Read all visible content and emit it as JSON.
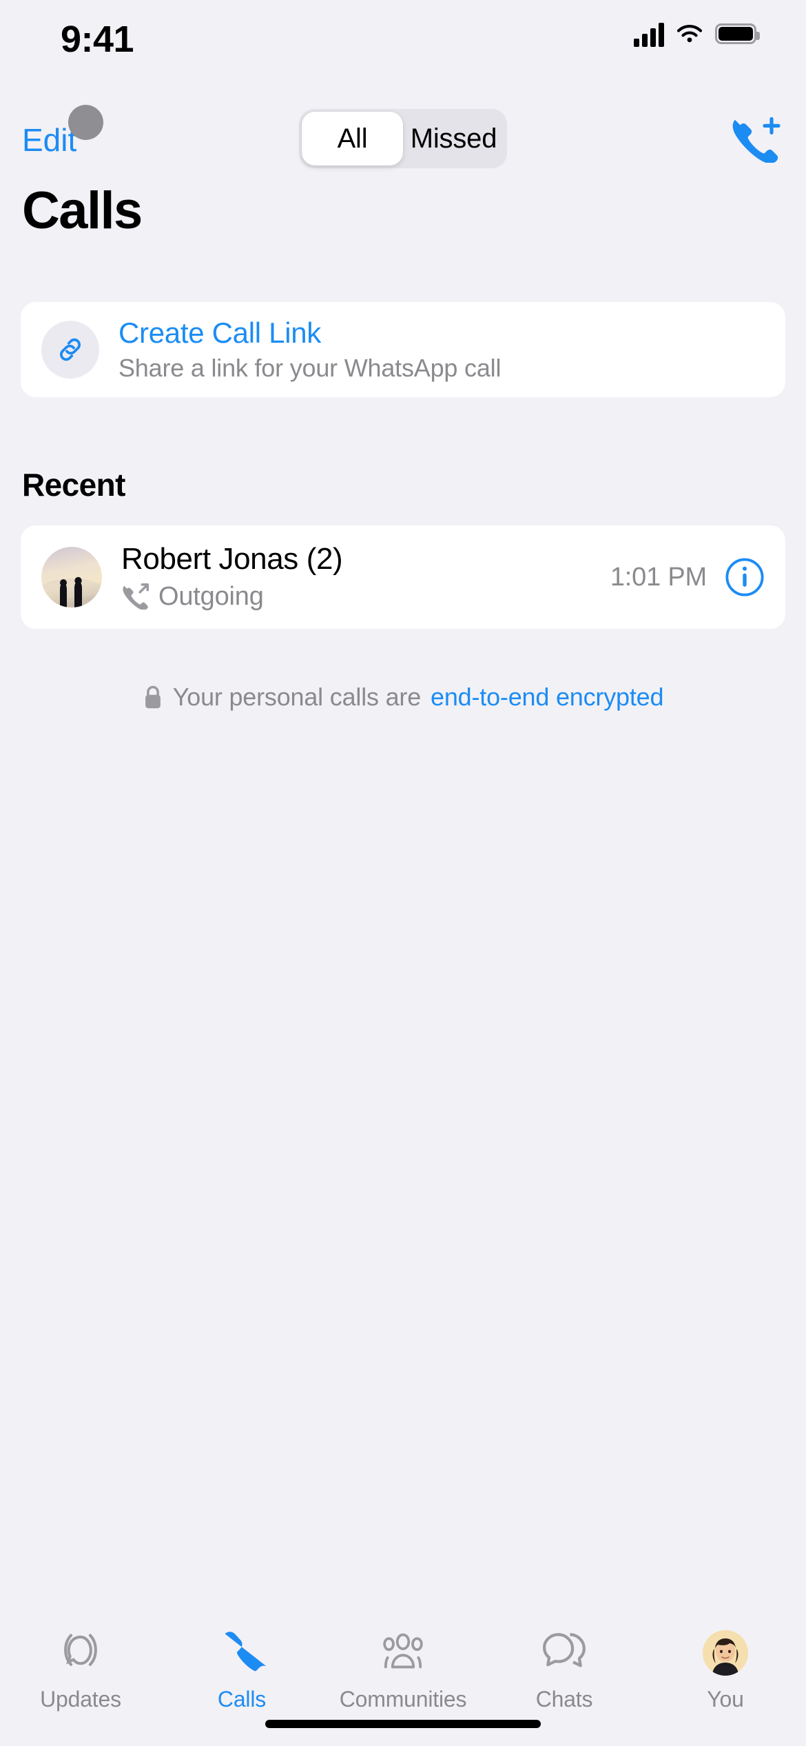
{
  "status_bar": {
    "time": "9:41",
    "signal_icon": "cellular-signal-icon",
    "wifi_icon": "wifi-icon",
    "battery_icon": "battery-icon"
  },
  "nav": {
    "edit_label": "Edit",
    "segments": [
      {
        "label": "All",
        "active": true
      },
      {
        "label": "Missed",
        "active": false
      }
    ],
    "new_call_icon": "phone-plus-icon"
  },
  "header": {
    "title": "Calls",
    "cursor_indicator": "touch-pointer-dot"
  },
  "create_call_link": {
    "icon": "link-chain-icon",
    "title": "Create Call Link",
    "subtitle": "Share a link for your WhatsApp call"
  },
  "recent": {
    "section_label": "Recent",
    "calls": [
      {
        "avatar": "contact-avatar-beach-couple",
        "name": "Robert Jonas (2)",
        "direction_icon": "outgoing-call-icon",
        "direction": "Outgoing",
        "time": "1:01 PM",
        "info_icon": "info-circle-icon"
      }
    ]
  },
  "encryption_note": {
    "lock_icon": "lock-icon",
    "text": "Your personal calls are",
    "link_text": "end-to-end encrypted"
  },
  "tab_bar": {
    "items": [
      {
        "label": "Updates",
        "icon": "updates-icon",
        "active": false
      },
      {
        "label": "Calls",
        "icon": "phone-icon",
        "active": true
      },
      {
        "label": "Communities",
        "icon": "communities-icon",
        "active": false
      },
      {
        "label": "Chats",
        "icon": "chats-icon",
        "active": false
      },
      {
        "label": "You",
        "icon": "profile-avatar-icon",
        "active": false
      }
    ]
  },
  "colors": {
    "accent": "#1c8cf3",
    "background": "#f2f1f6",
    "card": "#ffffff",
    "secondary_text": "#8a8a8e"
  }
}
